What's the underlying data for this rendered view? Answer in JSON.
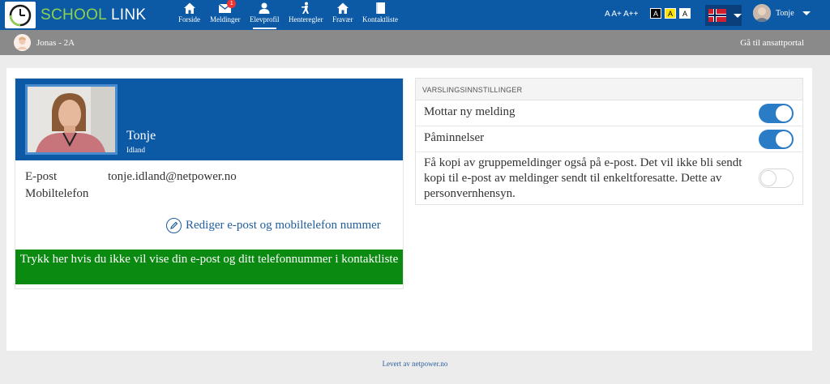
{
  "app": {
    "logo_school": "SCHOOL",
    "logo_link": "LINK"
  },
  "nav": [
    {
      "label": "Forside",
      "icon": "home-icon"
    },
    {
      "label": "Meldinger",
      "icon": "mail-icon",
      "badge": "1"
    },
    {
      "label": "Elevprofil",
      "icon": "user-icon",
      "active": true
    },
    {
      "label": "Henteregler",
      "icon": "person-walking-icon"
    },
    {
      "label": "Fravær",
      "icon": "home-icon"
    },
    {
      "label": "Kontaktliste",
      "icon": "book-icon"
    }
  ],
  "accessibility": {
    "font_sizes": "A A+ A++",
    "contrast_options": [
      "A",
      "A",
      "A"
    ]
  },
  "user": {
    "name": "Tonje"
  },
  "subbar": {
    "student": "Jonas - 2A",
    "link": "Gå til ansattportal"
  },
  "profile": {
    "name": "Tonje",
    "surname": "Idland",
    "email_label": "E-post",
    "phone_label": "Mobiltelefon",
    "email": "tonje.idland@netpower.no",
    "phone": "",
    "edit_link": "Rediger e-post og mobiltelefon nummer",
    "hide_button": "Trykk her hvis du ikke vil vise din e-post og ditt telefonnummer i kontaktliste"
  },
  "settings": {
    "title": "VARSLINGSINNSTILLINGER",
    "items": [
      {
        "label": "Mottar ny melding",
        "enabled": true
      },
      {
        "label": "Påminnelser",
        "enabled": true
      },
      {
        "label": "Få kopi av gruppemeldinger også på e-post. Det vil ikke bli sendt kopi til e-post av meldinger sendt til enkeltforesatte. Dette av personvernhensyn.",
        "enabled": false
      }
    ]
  },
  "footer": {
    "text": "Levert av netpower.no"
  },
  "colors": {
    "topbar": "#0c5aa6",
    "green": "#0b8a11",
    "toggle_on": "#2a7cc7",
    "subbar": "#8a8a8a"
  }
}
